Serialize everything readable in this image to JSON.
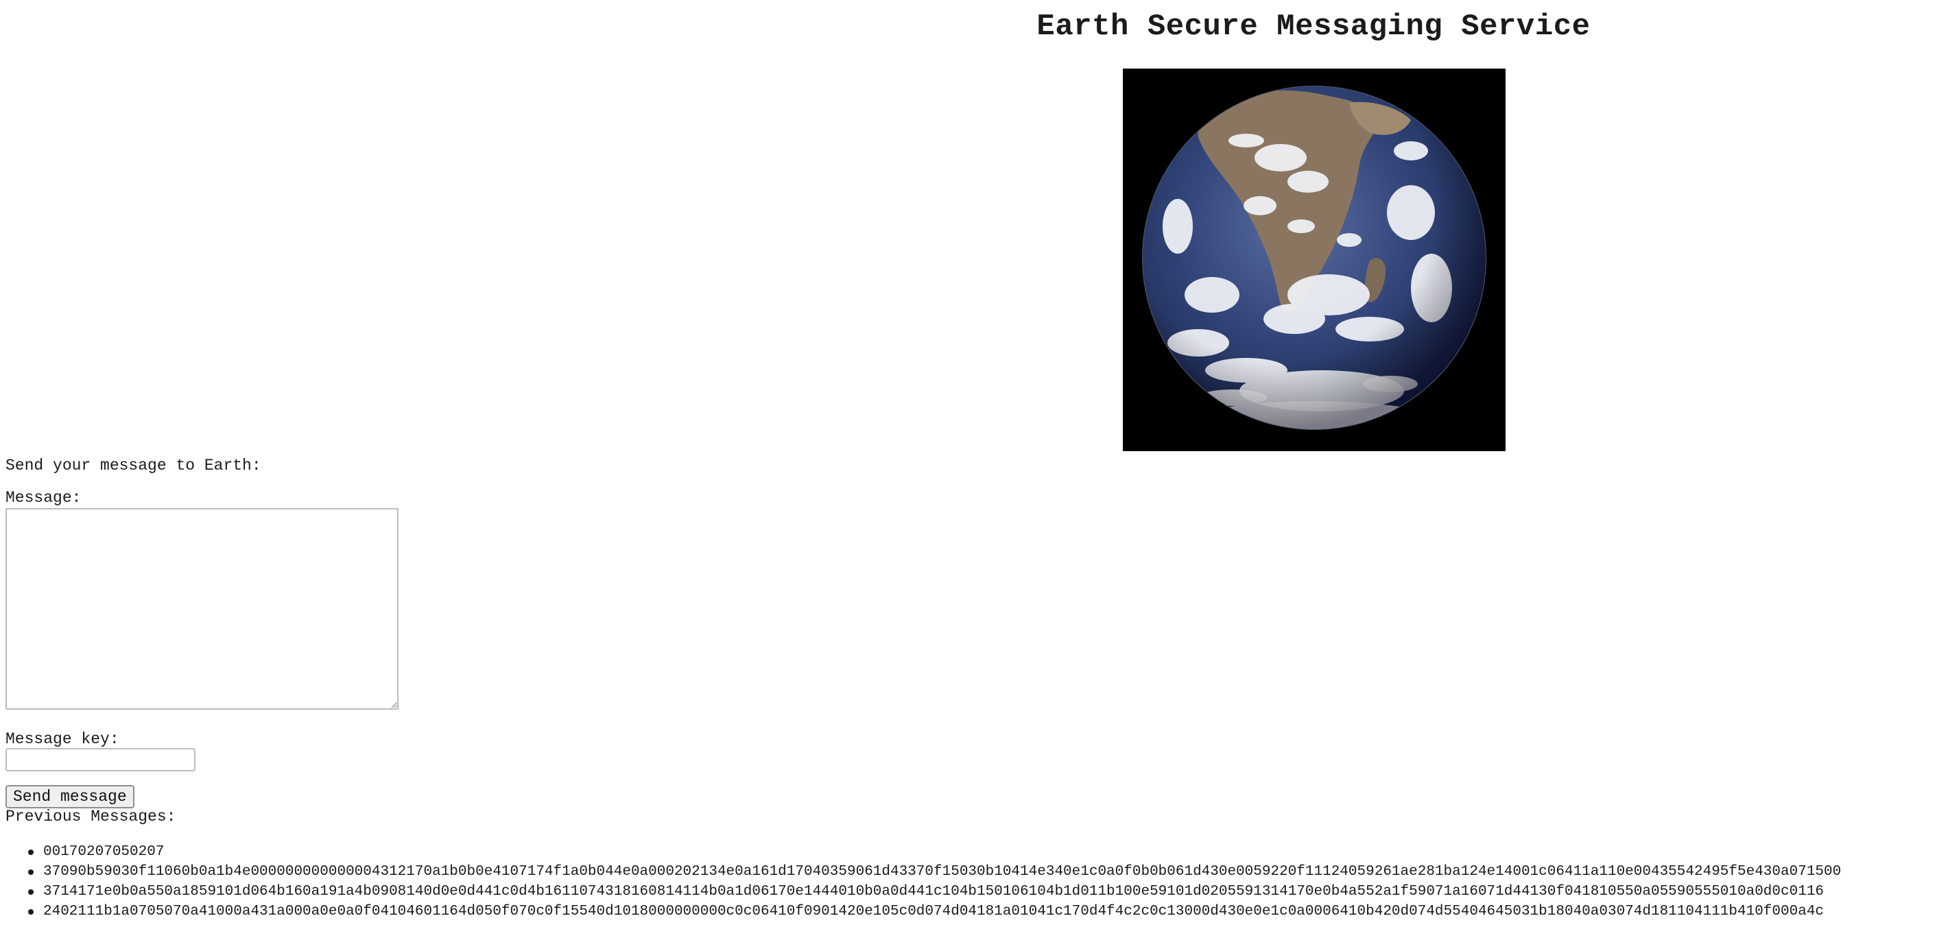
{
  "page": {
    "title": "Earth Secure Messaging Service",
    "image_alt": "Earth from space"
  },
  "form": {
    "intro": "Send your message to Earth:",
    "message_label": "Message:",
    "message_value": "",
    "key_label": "Message key:",
    "key_value": "",
    "send_label": "Send message"
  },
  "previous": {
    "heading": "Previous Messages:",
    "items": [
      "00170207050207",
      "37090b59030f11060b0a1b4e000000000000004312170a1b0b0e4107174f1a0b044e0a000202134e0a161d17040359061d43370f15030b10414e340e1c0a0f0b0b061d430e0059220f11124059261ae281ba124e14001c06411a110e00435542495f5e430a071500",
      "3714171e0b0a550a1859101d064b160a191a4b0908140d0e0d441c0d4b1611074318160814114b0a1d06170e1444010b0a0d441c104b150106104b1d011b100e59101d0205591314170e0b4a552a1f59071a16071d44130f041810550a05590555010a0d0c0116",
      "2402111b1a0705070a41000a431a000a0e0a0f04104601164d050f070c0f15540d1018000000000c0c06410f0901420e105c0d074d04181a01041c170d4f4c2c0c13000d430e0e1c0a0006410b420d074d55404645031b18040a03074d181104111b410f000a4c"
    ]
  },
  "colors": {
    "background": "#ffffff",
    "text": "#1b1b1b",
    "button_bg": "#efefef",
    "image_bg": "#000000"
  }
}
